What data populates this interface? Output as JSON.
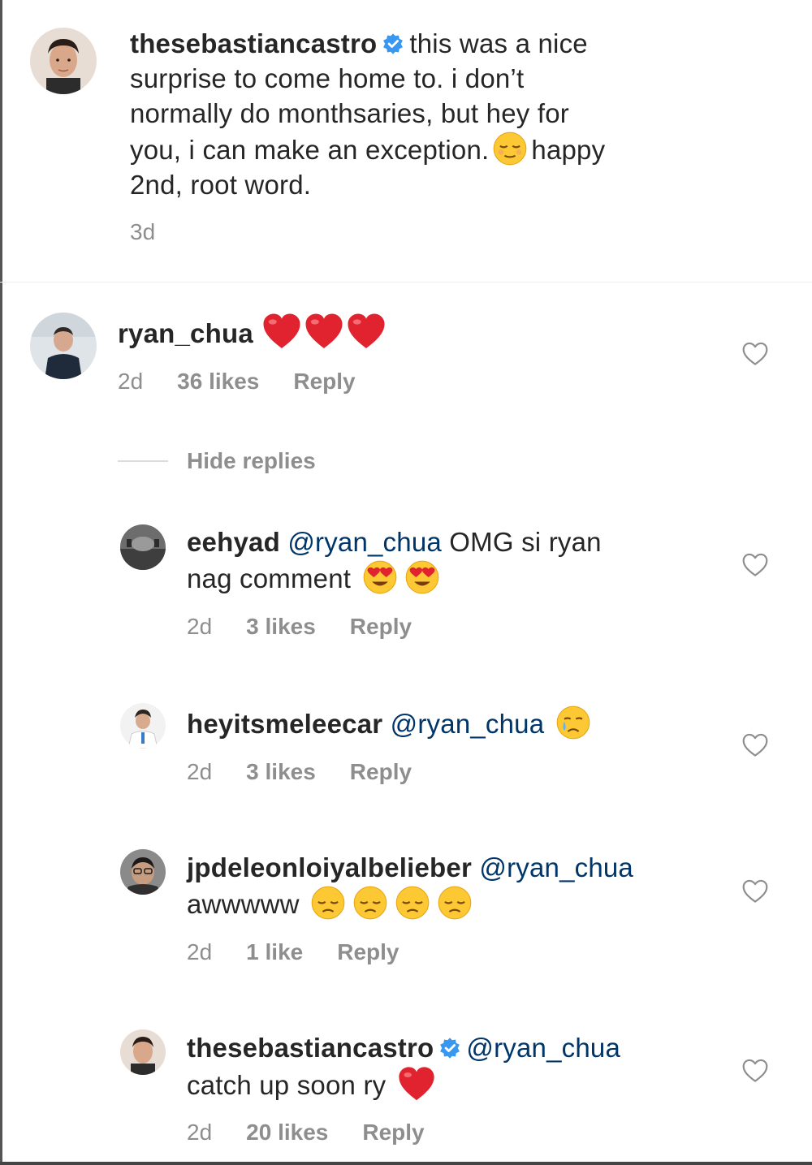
{
  "caption": {
    "username": "thesebastiancastro",
    "verified": true,
    "text_line1": "this was a nice",
    "text_line2": "surprise to come home to. i don’t",
    "text_line3": "normally do monthsaries, but hey for",
    "text_line4a": "you, i can make an exception.",
    "emoji": "relieved-face",
    "text_line4b": "happy",
    "text_line5": "2nd, root word.",
    "time": "3d"
  },
  "comment": {
    "username": "ryan_chua",
    "emojis": [
      "red-heart",
      "red-heart",
      "red-heart"
    ],
    "time": "2d",
    "likes": "36 likes",
    "reply": "Reply"
  },
  "hide_replies": "Hide replies",
  "replies": [
    {
      "username": "eehyad",
      "mention": "@ryan_chua",
      "text_line1": "OMG si ryan",
      "text_line2": "nag comment",
      "emojis": [
        "heart-eyes",
        "heart-eyes"
      ],
      "time": "2d",
      "likes": "3 likes",
      "reply": "Reply"
    },
    {
      "username": "heyitsmeleecar",
      "mention": "@ryan_chua",
      "emojis": [
        "crying-face"
      ],
      "time": "2d",
      "likes": "3 likes",
      "reply": "Reply"
    },
    {
      "username": "jpdeleonloiyalbelieber",
      "mention": "@ryan_chua",
      "text_line2": "awwwww",
      "emojis": [
        "disappointed-face",
        "disappointed-face",
        "disappointed-face",
        "disappointed-face"
      ],
      "time": "2d",
      "likes": "1 like",
      "reply": "Reply"
    },
    {
      "username": "thesebastiancastro",
      "verified": true,
      "mention": "@ryan_chua",
      "text_line2": "catch up soon ry",
      "emojis": [
        "red-heart"
      ],
      "time": "2d",
      "likes": "20 likes",
      "reply": "Reply"
    }
  ],
  "colors": {
    "text": "#262626",
    "meta": "#8e8e8e",
    "mention": "#003569",
    "verified": "#3897f0",
    "heart_emoji": "#e0232e"
  }
}
